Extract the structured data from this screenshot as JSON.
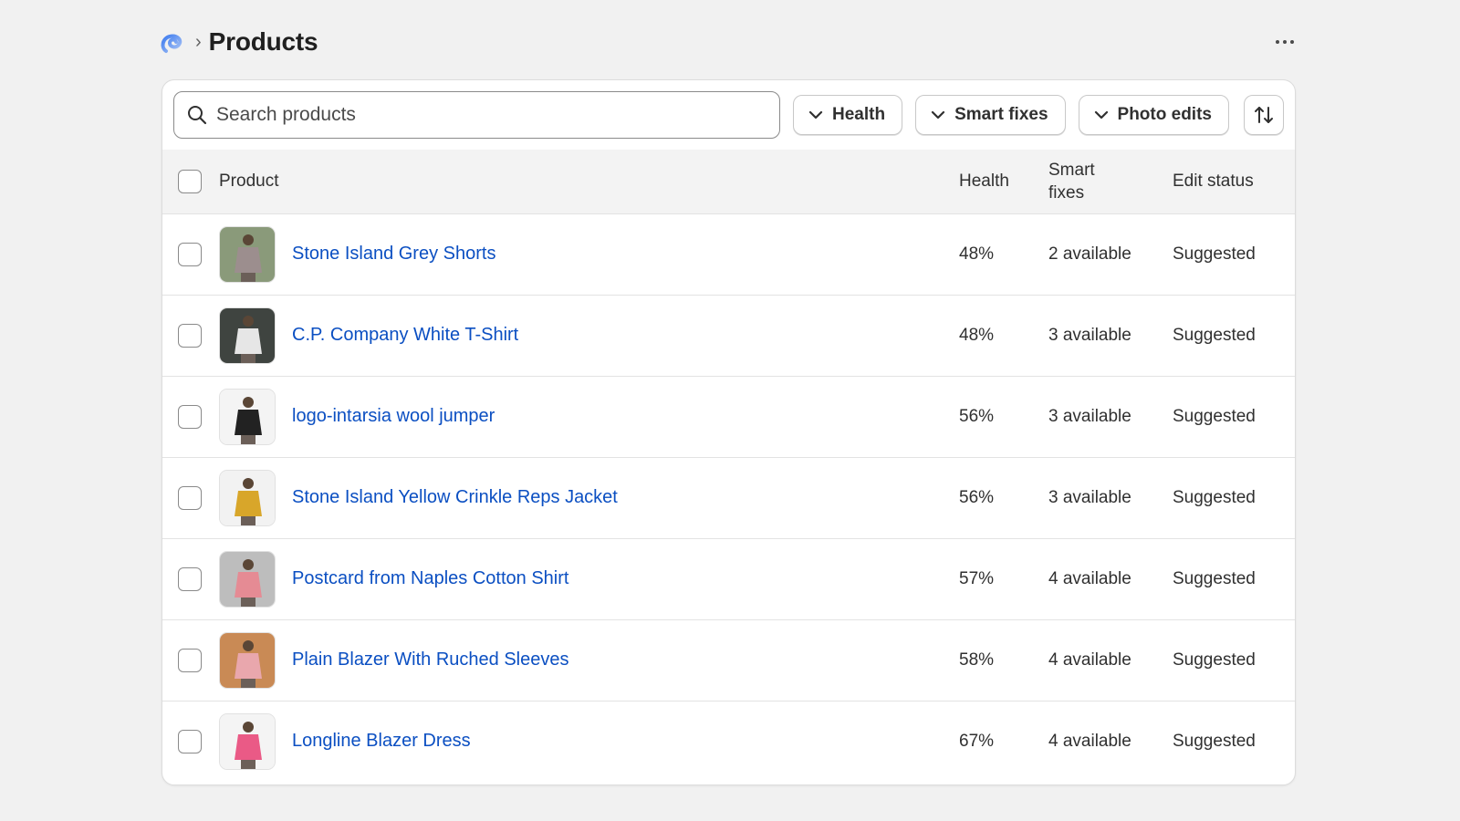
{
  "header": {
    "breadcrumb_separator": "›",
    "title": "Products",
    "more_icon": "ellipsis-horizontal-icon"
  },
  "toolbar": {
    "search_placeholder": "Search products",
    "filters": [
      {
        "label": "Health"
      },
      {
        "label": "Smart fixes"
      },
      {
        "label": "Photo edits"
      }
    ],
    "sort_icon": "sort-arrows-icon"
  },
  "table": {
    "columns": {
      "product": "Product",
      "health": "Health",
      "smart_fixes_line1": "Smart",
      "smart_fixes_line2": "fixes",
      "edit_status": "Edit status"
    },
    "rows": [
      {
        "name": "Stone Island Grey Shorts",
        "health": "48%",
        "smart_fixes": "2 available",
        "edit_status": "Suggested",
        "thumb_bg": "#8a9a7a",
        "thumb_fg": "#9c8e8e"
      },
      {
        "name": "C.P. Company White T-Shirt",
        "health": "48%",
        "smart_fixes": "3 available",
        "edit_status": "Suggested",
        "thumb_bg": "#3f4440",
        "thumb_fg": "#e6e6e6"
      },
      {
        "name": "logo-intarsia wool jumper",
        "health": "56%",
        "smart_fixes": "3 available",
        "edit_status": "Suggested",
        "thumb_bg": "#f4f4f4",
        "thumb_fg": "#222222"
      },
      {
        "name": "Stone Island Yellow Crinkle Reps Jacket",
        "health": "56%",
        "smart_fixes": "3 available",
        "edit_status": "Suggested",
        "thumb_bg": "#f2f2f2",
        "thumb_fg": "#d8a62a"
      },
      {
        "name": "Postcard from Naples Cotton Shirt",
        "health": "57%",
        "smart_fixes": "4 available",
        "edit_status": "Suggested",
        "thumb_bg": "#bdbdbd",
        "thumb_fg": "#e58b94"
      },
      {
        "name": "Plain Blazer With Ruched Sleeves",
        "health": "58%",
        "smart_fixes": "4 available",
        "edit_status": "Suggested",
        "thumb_bg": "#c98a55",
        "thumb_fg": "#e9a7ad"
      },
      {
        "name": "Longline Blazer Dress",
        "health": "67%",
        "smart_fixes": "4 available",
        "edit_status": "Suggested",
        "thumb_bg": "#f4f4f4",
        "thumb_fg": "#ea5a86"
      }
    ]
  },
  "colors": {
    "link": "#0b4fc2",
    "logo_start": "#2f6ee6",
    "logo_end": "#9bb8f2"
  }
}
